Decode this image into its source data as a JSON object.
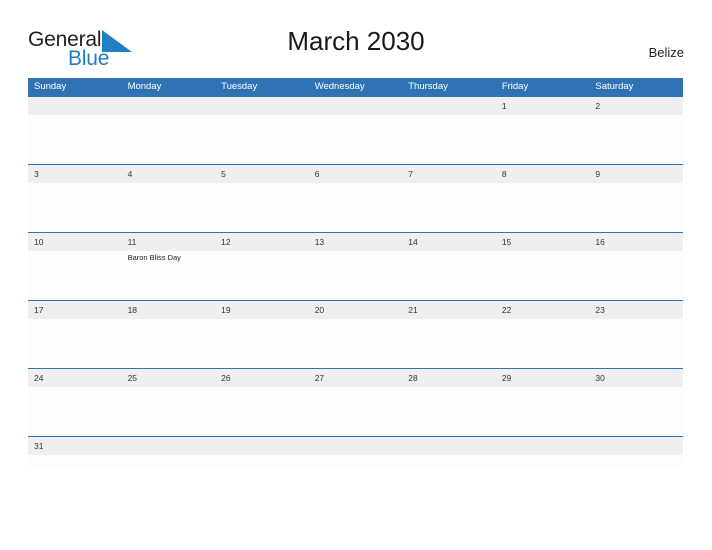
{
  "brand": {
    "word_one": "General",
    "word_two": "Blue",
    "sail_icon": "sail-triangle-icon",
    "accent_color": "#1f7fc4",
    "dark_color": "#231f20"
  },
  "header": {
    "title": "March 2030",
    "country": "Belize"
  },
  "colors": {
    "header_blue": "#2f73b4",
    "band_gray": "#efefef",
    "cell_white": "#fdfdfd"
  },
  "calendar": {
    "month": "March",
    "year": "2030",
    "day_headers": [
      "Sunday",
      "Monday",
      "Tuesday",
      "Wednesday",
      "Thursday",
      "Friday",
      "Saturday"
    ],
    "weeks": [
      {
        "days": [
          {
            "number": "",
            "event": ""
          },
          {
            "number": "",
            "event": ""
          },
          {
            "number": "",
            "event": ""
          },
          {
            "number": "",
            "event": ""
          },
          {
            "number": "",
            "event": ""
          },
          {
            "number": "1",
            "event": ""
          },
          {
            "number": "2",
            "event": ""
          }
        ]
      },
      {
        "days": [
          {
            "number": "3",
            "event": ""
          },
          {
            "number": "4",
            "event": ""
          },
          {
            "number": "5",
            "event": ""
          },
          {
            "number": "6",
            "event": ""
          },
          {
            "number": "7",
            "event": ""
          },
          {
            "number": "8",
            "event": ""
          },
          {
            "number": "9",
            "event": ""
          }
        ]
      },
      {
        "days": [
          {
            "number": "10",
            "event": ""
          },
          {
            "number": "11",
            "event": "Baron Bliss Day"
          },
          {
            "number": "12",
            "event": ""
          },
          {
            "number": "13",
            "event": ""
          },
          {
            "number": "14",
            "event": ""
          },
          {
            "number": "15",
            "event": ""
          },
          {
            "number": "16",
            "event": ""
          }
        ]
      },
      {
        "days": [
          {
            "number": "17",
            "event": ""
          },
          {
            "number": "18",
            "event": ""
          },
          {
            "number": "19",
            "event": ""
          },
          {
            "number": "20",
            "event": ""
          },
          {
            "number": "21",
            "event": ""
          },
          {
            "number": "22",
            "event": ""
          },
          {
            "number": "23",
            "event": ""
          }
        ]
      },
      {
        "days": [
          {
            "number": "24",
            "event": ""
          },
          {
            "number": "25",
            "event": ""
          },
          {
            "number": "26",
            "event": ""
          },
          {
            "number": "27",
            "event": ""
          },
          {
            "number": "28",
            "event": ""
          },
          {
            "number": "29",
            "event": ""
          },
          {
            "number": "30",
            "event": ""
          }
        ]
      },
      {
        "days": [
          {
            "number": "31",
            "event": ""
          },
          {
            "number": "",
            "event": ""
          },
          {
            "number": "",
            "event": ""
          },
          {
            "number": "",
            "event": ""
          },
          {
            "number": "",
            "event": ""
          },
          {
            "number": "",
            "event": ""
          },
          {
            "number": "",
            "event": ""
          }
        ]
      }
    ]
  }
}
